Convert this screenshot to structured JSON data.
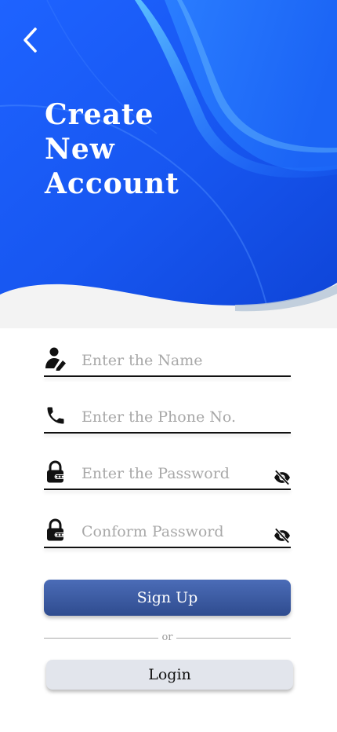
{
  "header": {
    "title_lines": [
      "Create",
      "New",
      "Account"
    ],
    "back_icon": "chevron-left-icon"
  },
  "form": {
    "name": {
      "placeholder": "Enter the Name",
      "value": "",
      "icon": "user-edit-icon"
    },
    "phone": {
      "placeholder": "Enter the Phone No.",
      "value": "",
      "icon": "phone-icon"
    },
    "password": {
      "placeholder": "Enter the Password",
      "value": "",
      "icon": "lock-icon",
      "toggle_icon": "eye-off-icon"
    },
    "confirm_password": {
      "placeholder": "Conform Password",
      "value": "",
      "icon": "lock-icon",
      "toggle_icon": "eye-off-icon"
    }
  },
  "actions": {
    "signup_label": "Sign Up",
    "divider_text": "or",
    "login_label": "Login"
  },
  "colors": {
    "hero_blue": "#1a5cf0",
    "signup_gradient_top": "#4b6cb7",
    "signup_gradient_bottom": "#2f4c8f",
    "login_bg": "#e2e5ec"
  }
}
